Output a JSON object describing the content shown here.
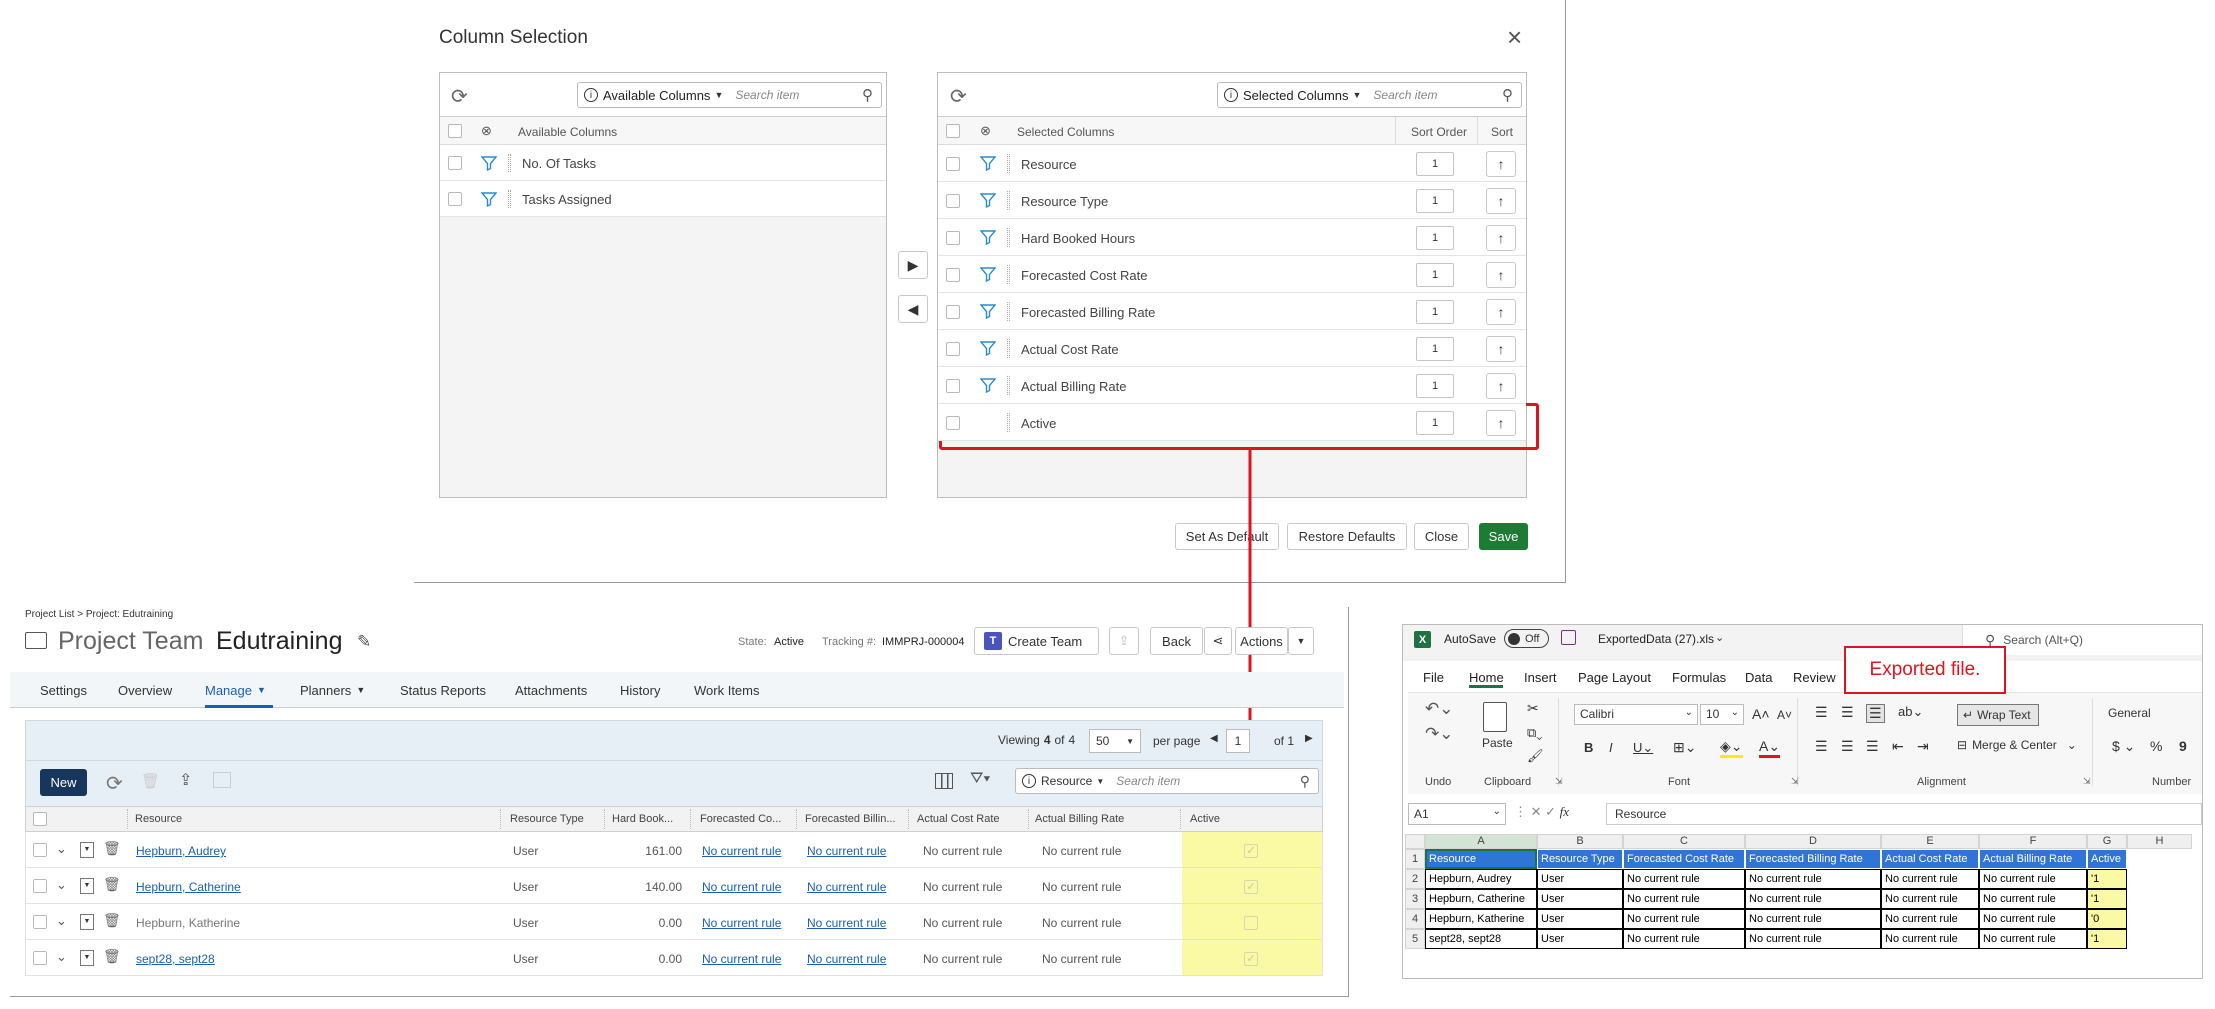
{
  "dialog": {
    "title": "Column Selection",
    "avail_dd": "Available Columns",
    "avail_search": "Search item",
    "avail_header": "Available Columns",
    "available": [
      "No. Of Tasks",
      "Tasks Assigned"
    ],
    "sel_dd": "Selected Columns",
    "sel_search": "Search item",
    "sel_header": "Selected Columns",
    "sort_order_header": "Sort Order",
    "sort_header": "Sort",
    "selected": [
      {
        "name": "Resource",
        "order": "1"
      },
      {
        "name": "Resource Type",
        "order": "1"
      },
      {
        "name": "Hard Booked Hours",
        "order": "1"
      },
      {
        "name": "Forecasted Cost Rate",
        "order": "1"
      },
      {
        "name": "Forecasted Billing Rate",
        "order": "1"
      },
      {
        "name": "Actual Cost Rate",
        "order": "1"
      },
      {
        "name": "Actual Billing Rate",
        "order": "1"
      },
      {
        "name": "Active",
        "order": "1"
      }
    ],
    "btn_default": "Set As Default",
    "btn_restore": "Restore Defaults",
    "btn_close": "Close",
    "btn_save": "Save"
  },
  "project": {
    "breadcrumb": "Project List > Project: Edutraining",
    "team_label": "Project Team",
    "name": "Edutraining",
    "state_label": "State:",
    "state": "Active",
    "tracking_label": "Tracking #:",
    "tracking": "IMMPRJ-000004",
    "create_team": "Create Team",
    "back": "Back",
    "actions": "Actions",
    "tabs": [
      "Settings",
      "Overview",
      "Manage",
      "Planners",
      "Status Reports",
      "Attachments",
      "History",
      "Work Items"
    ],
    "viewing_prefix": "Viewing",
    "viewing_count": "4",
    "viewing_of": "of",
    "viewing_total": "4",
    "page_size": "50",
    "per_page": "per page",
    "page": "1",
    "of_pages": "of 1",
    "new": "New",
    "search_field": "Resource",
    "search_placeholder": "Search item",
    "columns": [
      "Resource",
      "Resource Type",
      "Hard Book...",
      "Forecasted Co...",
      "Forecasted Billin...",
      "Actual Cost Rate",
      "Actual Billing Rate",
      "Active"
    ],
    "rows": [
      {
        "name": "Hepburn, Audrey",
        "type": "User",
        "hours": "161.00",
        "fcr": "No current rule",
        "fbr": "No current rule",
        "acr": "No current rule",
        "abr": "No current rule",
        "active": true
      },
      {
        "name": "Hepburn, Catherine",
        "type": "User",
        "hours": "140.00",
        "fcr": "No current rule",
        "fbr": "No current rule",
        "acr": "No current rule",
        "abr": "No current rule",
        "active": true
      },
      {
        "name": "Hepburn, Katherine",
        "type": "User",
        "hours": "0.00",
        "fcr": "No current rule",
        "fbr": "No current rule",
        "acr": "No current rule",
        "abr": "No current rule",
        "active": false
      },
      {
        "name": "sept28, sept28",
        "type": "User",
        "hours": "0.00",
        "fcr": "No current rule",
        "fbr": "No current rule",
        "acr": "No current rule",
        "abr": "No current rule",
        "active": true
      }
    ]
  },
  "excel": {
    "autosave": "AutoSave",
    "off": "Off",
    "filename": "ExportedData (27).xls",
    "search": "Search (Alt+Q)",
    "menu": [
      "File",
      "Home",
      "Insert",
      "Page Layout",
      "Formulas",
      "Data",
      "Review"
    ],
    "paste": "Paste",
    "font": "Calibri",
    "size": "10",
    "wrap": "Wrap Text",
    "merge": "Merge & Center",
    "number_format": "General",
    "groups": [
      "Undo",
      "Clipboard",
      "Font",
      "Alignment",
      "Number"
    ],
    "namebox": "A1",
    "formula": "Resource",
    "cols": [
      "A",
      "B",
      "C",
      "D",
      "E",
      "F",
      "G",
      "H"
    ],
    "grid": [
      [
        "Resource",
        "Resource Type",
        "Forecasted Cost Rate",
        "Forecasted Billing Rate",
        "Actual Cost Rate",
        "Actual Billing Rate",
        "Active"
      ],
      [
        "Hepburn, Audrey",
        "User",
        "No current rule",
        "No current rule",
        "No current rule",
        "No current rule",
        "'1"
      ],
      [
        "Hepburn, Catherine",
        "User",
        "No current rule",
        "No current rule",
        "No current rule",
        "No current rule",
        "'1"
      ],
      [
        "Hepburn, Katherine",
        "User",
        "No current rule",
        "No current rule",
        "No current rule",
        "No current rule",
        "'0"
      ],
      [
        "sept28, sept28",
        "User",
        "No current rule",
        "No current rule",
        "No current rule",
        "No current rule",
        "'1"
      ]
    ]
  },
  "callout": "Exported file.",
  "colors": {
    "accent_red": "#e0141e",
    "save_green": "#1e7b34",
    "active_yellow": "#fafaa5",
    "excel_header_blue": "#2f75d6",
    "brand_navy": "#17365d"
  }
}
